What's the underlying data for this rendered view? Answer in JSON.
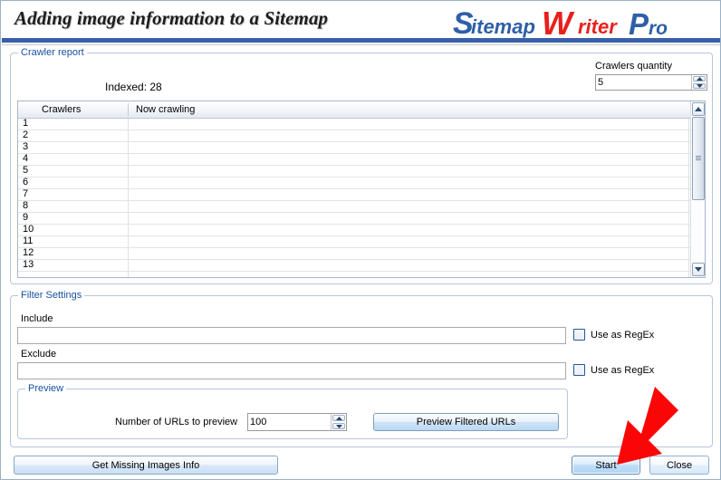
{
  "window": {
    "title": "Adding image information to a Sitemap",
    "accent_blue": "#3860a8",
    "group_label_color": "#1752a0"
  },
  "logo": {
    "part1": "Sitemap",
    "part2": "Writer",
    "part3": "Pro",
    "part1_color": "#2e5fa8",
    "part2_color": "#e8201c",
    "part3_color": "#2e5fa8"
  },
  "crawler_report": {
    "group_title": "Crawler report",
    "indexed_label": "Indexed: 28",
    "quantity_label": "Crawlers quantity",
    "quantity_value": "5",
    "columns": [
      "Crawlers",
      "Now crawling"
    ],
    "rows": [
      {
        "num": "1",
        "now": ""
      },
      {
        "num": "2",
        "now": ""
      },
      {
        "num": "3",
        "now": ""
      },
      {
        "num": "4",
        "now": ""
      },
      {
        "num": "5",
        "now": ""
      },
      {
        "num": "6",
        "now": ""
      },
      {
        "num": "7",
        "now": ""
      },
      {
        "num": "8",
        "now": ""
      },
      {
        "num": "9",
        "now": ""
      },
      {
        "num": "10",
        "now": ""
      },
      {
        "num": "11",
        "now": ""
      },
      {
        "num": "12",
        "now": ""
      },
      {
        "num": "13",
        "now": ""
      }
    ]
  },
  "filter_settings": {
    "group_title": "Filter Settings",
    "include_label": "Include",
    "include_value": "",
    "include_placeholder": "",
    "exclude_label": "Exclude",
    "exclude_value": "",
    "exclude_placeholder": "",
    "regex_label_1": "Use as RegEx",
    "regex_label_2": "Use as RegEx",
    "regex_checked_1": false,
    "regex_checked_2": false
  },
  "preview": {
    "group_title": "Preview",
    "num_urls_label": "Number of URLs to preview",
    "num_urls_value": "100",
    "preview_button": "Preview Filtered URLs"
  },
  "footer": {
    "get_missing_images": "Get Missing Images Info",
    "start": "Start",
    "close": "Close"
  },
  "annotation": {
    "arrow_color": "#fb0606",
    "arrow_points_to": "Start"
  }
}
